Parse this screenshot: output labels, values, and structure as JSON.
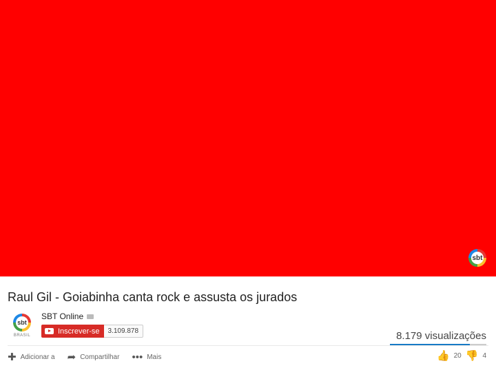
{
  "video": {
    "background_color": "#ff0000",
    "watermark_text": "sbt"
  },
  "title": "Raul Gil - Goiabinha canta rock e assusta os jurados",
  "channel": {
    "name": "SBT Online",
    "logo_text": "sbt",
    "logo_subtext": "BRASIL"
  },
  "subscribe": {
    "label": "Inscrever-se",
    "count": "3.109.878",
    "color": "#d72b26"
  },
  "views": "8.179 visualizações",
  "actions": {
    "add_label": "Adicionar a",
    "share_label": "Compartilhar",
    "more_label": "Mais"
  },
  "rating": {
    "likes": "20",
    "dislikes": "4",
    "like_ratio": 0.83
  },
  "icons": {
    "add": "plus-icon",
    "share": "share-arrow-icon",
    "more": "ellipsis-icon",
    "like": "thumbs-up-icon",
    "dislike": "thumbs-down-icon"
  }
}
